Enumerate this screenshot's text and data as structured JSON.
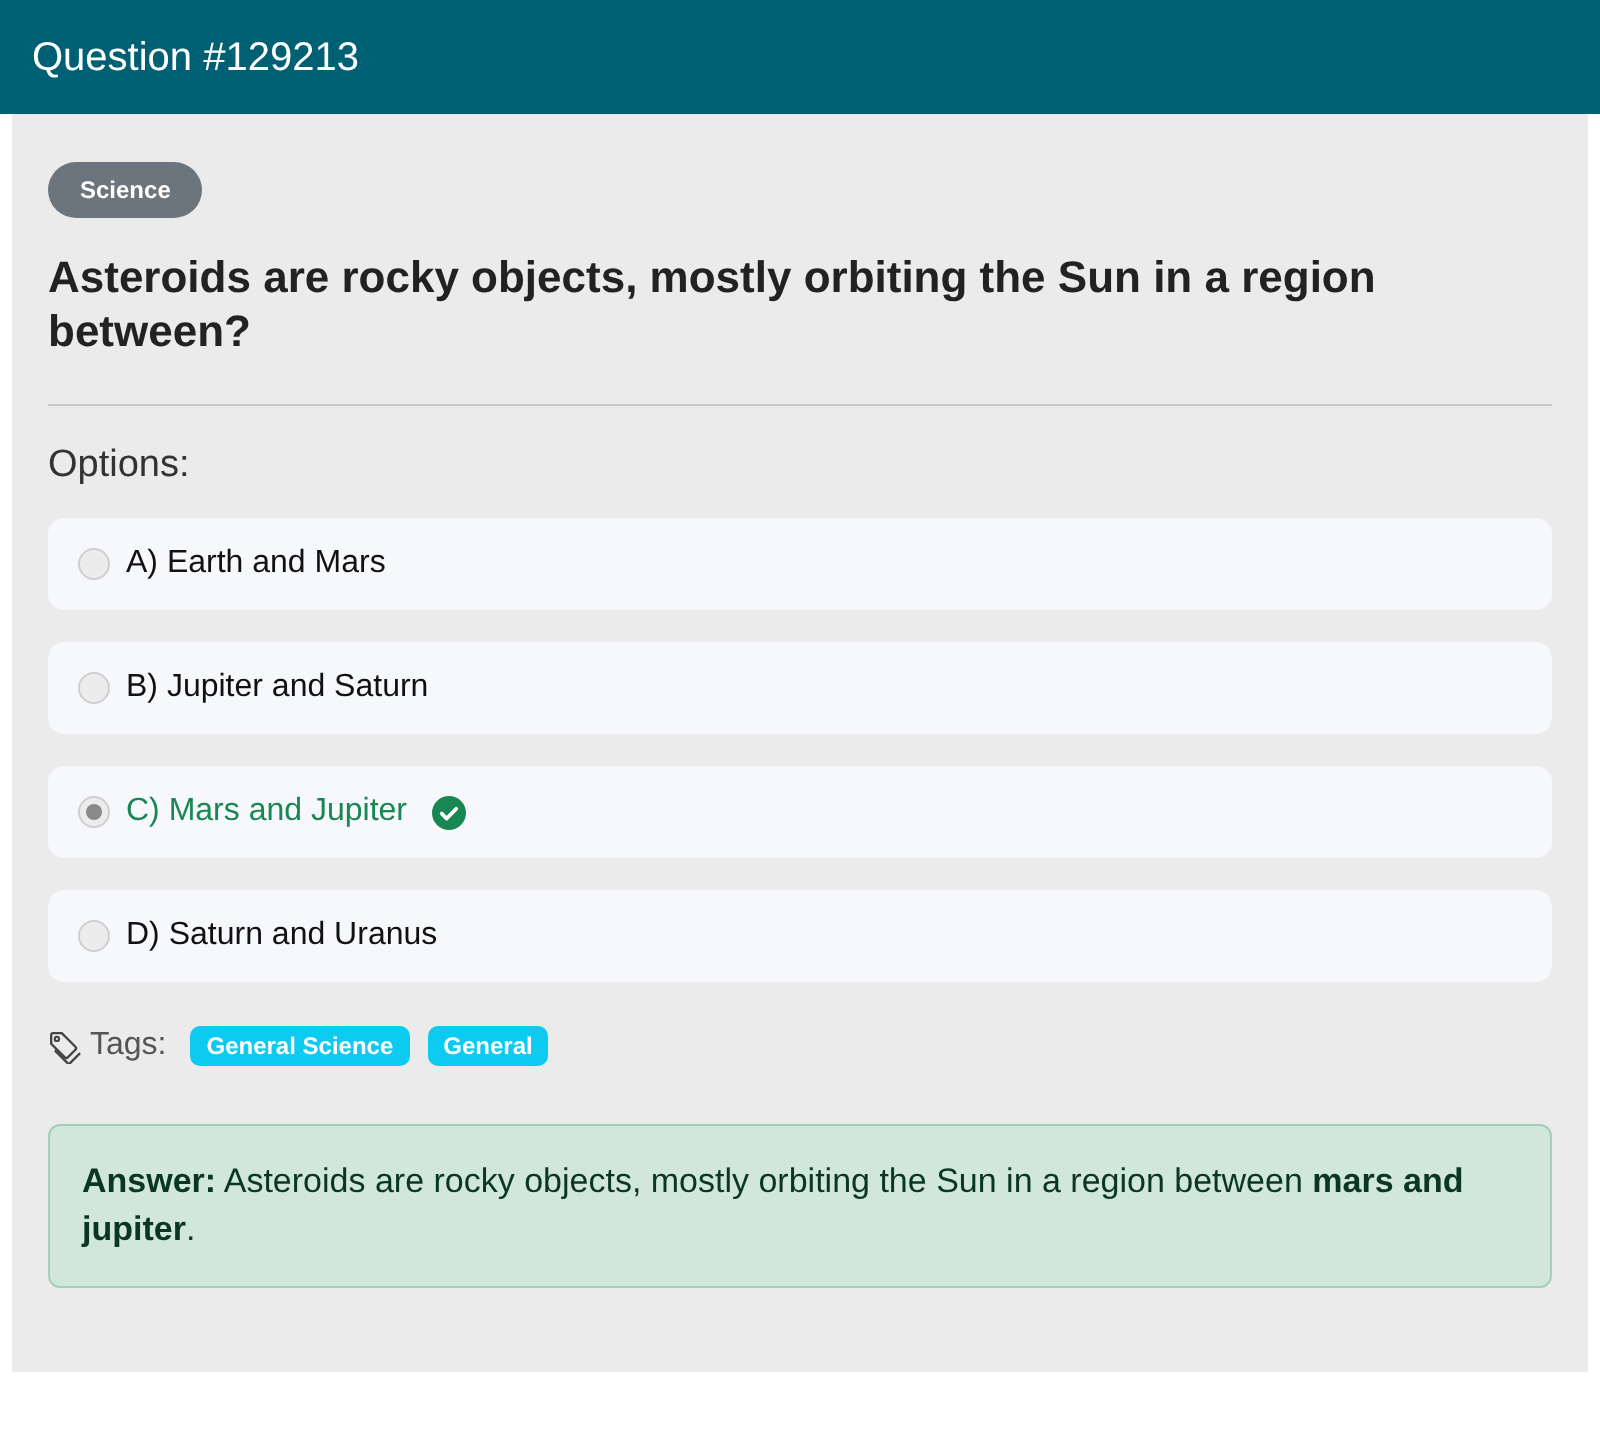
{
  "header": {
    "title": "Question #129213"
  },
  "category": {
    "label": "Science"
  },
  "question": "Asteroids are rocky objects, mostly orbiting the Sun in a region between?",
  "options_label": "Options:",
  "options": [
    {
      "label": "A) Earth and Mars",
      "selected": false,
      "correct": false
    },
    {
      "label": "B) Jupiter and Saturn",
      "selected": false,
      "correct": false
    },
    {
      "label": "C) Mars and Jupiter",
      "selected": true,
      "correct": true
    },
    {
      "label": "D) Saturn and Uranus",
      "selected": false,
      "correct": false
    }
  ],
  "tags": {
    "label": "Tags:",
    "items": [
      "General Science",
      "General"
    ]
  },
  "answer": "**Answer:** Asteroids are rocky objects, mostly orbiting the Sun in a region between **mars and jupiter**."
}
